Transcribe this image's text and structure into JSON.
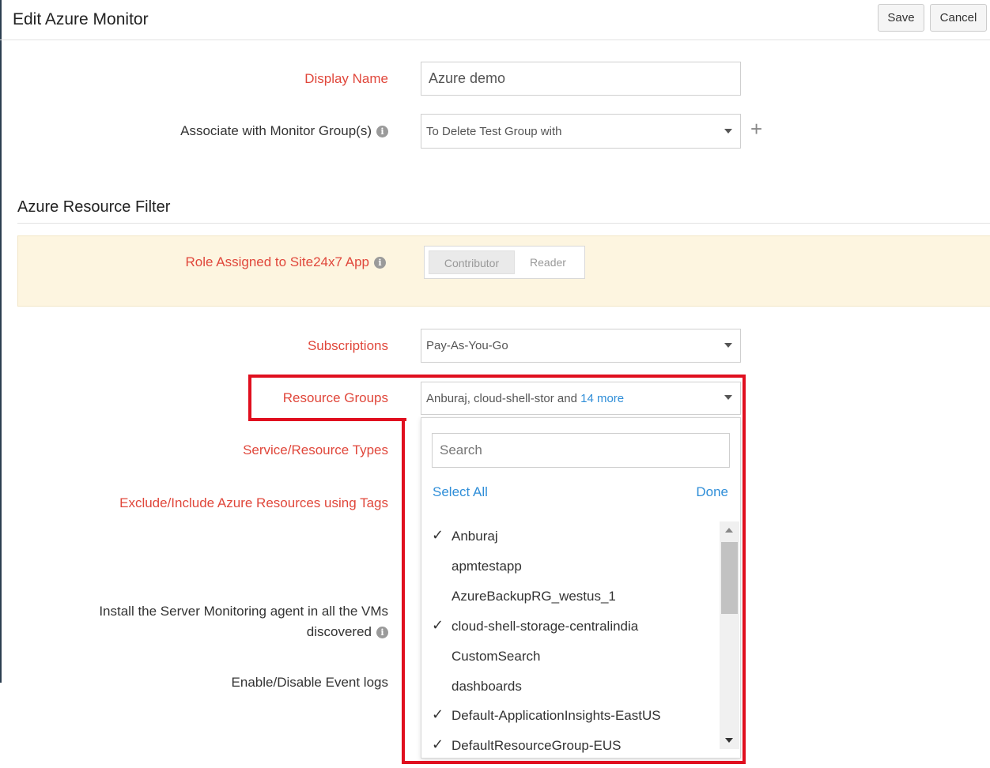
{
  "header": {
    "title": "Edit Azure Monitor",
    "save_label": "Save",
    "cancel_label": "Cancel"
  },
  "form": {
    "display_name": {
      "label": "Display Name",
      "value": "Azure demo"
    },
    "monitor_group": {
      "label": "Associate with Monitor Group(s)",
      "value": "To Delete Test Group with"
    },
    "section_title": "Azure Resource Filter",
    "role": {
      "label": "Role Assigned to Site24x7 App",
      "options": [
        "Contributor",
        "Reader"
      ],
      "selected": "Contributor"
    },
    "subscriptions": {
      "label": "Subscriptions",
      "value": "Pay-As-You-Go"
    },
    "resource_groups": {
      "label": "Resource Groups",
      "summary": "Anburaj, cloud-shell-stor and",
      "more_link": "14 more"
    },
    "service_types": {
      "label": "Service/Resource Types"
    },
    "tags": {
      "label": "Exclude/Include Azure Resources using Tags"
    },
    "server_agent": {
      "label_line1": "Install the Server Monitoring agent in all the VMs",
      "label_line2": "discovered"
    },
    "event_logs": {
      "label": "Enable/Disable Event logs"
    }
  },
  "dropdown": {
    "search_placeholder": "Search",
    "select_all_label": "Select All",
    "done_label": "Done",
    "options": [
      {
        "label": "Anburaj",
        "checked": true
      },
      {
        "label": "apmtestapp",
        "checked": false
      },
      {
        "label": "AzureBackupRG_westus_1",
        "checked": false
      },
      {
        "label": "cloud-shell-storage-centralindia",
        "checked": true
      },
      {
        "label": "CustomSearch",
        "checked": false
      },
      {
        "label": "dashboards",
        "checked": false
      },
      {
        "label": "Default-ApplicationInsights-EastUS",
        "checked": true
      },
      {
        "label": "DefaultResourceGroup-EUS",
        "checked": true
      }
    ]
  },
  "icons": {
    "info": "info-icon",
    "plus": "plus-icon",
    "check": "check-icon",
    "caret": "chevron-down-icon"
  },
  "colors": {
    "required_label": "#e0473b",
    "link": "#2f8ed8",
    "highlight_box": "#e00f1f",
    "role_panel_bg": "#fdf5e0"
  }
}
